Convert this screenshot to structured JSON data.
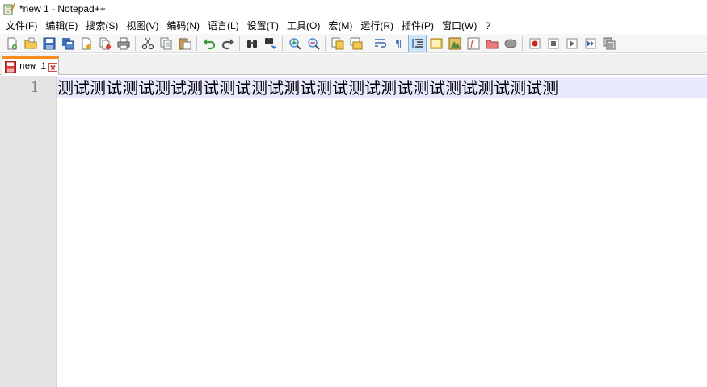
{
  "window": {
    "title": "*new 1 - Notepad++"
  },
  "menu": [
    "文件(F)",
    "编辑(E)",
    "搜索(S)",
    "视图(V)",
    "编码(N)",
    "语言(L)",
    "设置(T)",
    "工具(O)",
    "宏(M)",
    "运行(R)",
    "插件(P)",
    "窗口(W)",
    "?"
  ],
  "toolbar_icons": [
    "new-file-icon",
    "open-file-icon",
    "save-icon",
    "save-all-icon",
    "close-icon",
    "close-all-icon",
    "print-icon",
    "cut-icon",
    "copy-icon",
    "paste-icon",
    "undo-icon",
    "redo-icon",
    "find-icon",
    "replace-icon",
    "zoom-in-icon",
    "zoom-out-icon",
    "sync-vertical-icon",
    "sync-horizontal-icon",
    "word-wrap-icon",
    "show-all-chars-icon",
    "indent-guide-icon",
    "user-language-icon",
    "document-map-icon",
    "function-list-icon",
    "folder-workspace-icon",
    "monitoring-icon",
    "record-macro-icon",
    "stop-macro-icon",
    "play-macro-icon",
    "run-macro-multiple-icon",
    "save-macro-icon"
  ],
  "tab": {
    "label": "new 1"
  },
  "editor": {
    "line_number": "1",
    "line_text": "测试测试测试测试测试测试测试测试测试测试测试测试测试测试测试测"
  },
  "colors": {
    "tab_accent": "#fa8c1e",
    "current_line": "#e8e8ff",
    "gutter": "#e4e4e4"
  }
}
